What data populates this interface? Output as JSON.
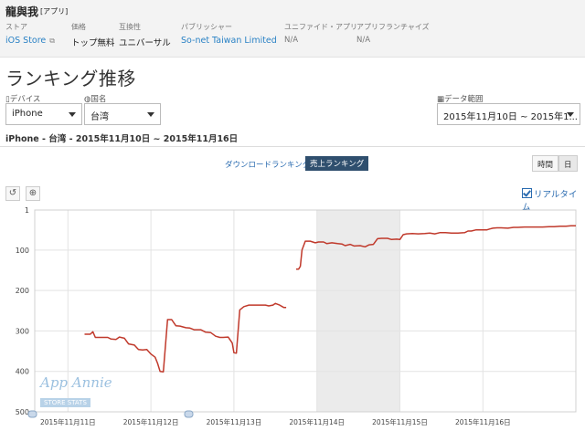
{
  "app": {
    "name": "龍與我",
    "tag": "[アプリ]"
  },
  "meta": {
    "store_label": "ストア",
    "store_value": "iOS Store",
    "price_label": "価格",
    "price_value": "トップ無料",
    "compat_label": "互換性",
    "compat_value": "ユニバーサル",
    "publisher_label": "パブリッシャー",
    "publisher_value": "So-net Taiwan Limited",
    "unified_label": "ユニファイド・アプリ",
    "unified_value": "N/A",
    "franchise_label": "アプリフランチャイズ",
    "franchise_value": "N/A"
  },
  "section_title": "ランキング推移",
  "filters": {
    "device_label": "デバイス",
    "device_value": "iPhone",
    "country_label": "国名",
    "country_value": "台湾",
    "date_label": "データ範囲",
    "date_value": "2015年11月10日 ~ 2015年1..."
  },
  "range_text": "iPhone - 台湾 - 2015年11月10日 ~ 2015年11月16日",
  "tabs": {
    "downloads": "ダウンロードランキング",
    "sales": "売上ランキング"
  },
  "granularity": {
    "hour": "時間",
    "day": "日"
  },
  "realtime_label": "リアルタイム",
  "watermark": {
    "brand": "App Annie",
    "sub": "STORE STATS"
  },
  "colors": {
    "line": "#c0392b",
    "shade": "#ebebeb",
    "accent": "#2a82c5"
  },
  "chart_data": {
    "type": "line",
    "title": "",
    "xlabel": "",
    "ylabel": "",
    "y_inverted": true,
    "ylim": [
      1,
      500
    ],
    "yticks": [
      "1",
      "100",
      "200",
      "300",
      "400",
      "500"
    ],
    "xticks": [
      "2015年11月11日",
      "2015年11月12日",
      "2015年11月13日",
      "2015年11月14日",
      "2015年11月15日",
      "2015年11月16日"
    ],
    "x_unit": "days since 2015-11-10 00:00",
    "grid": true,
    "shaded_range": [
      4.0,
      5.0
    ],
    "series": [
      {
        "name": "",
        "segments": [
          [
            [
              1.2,
              308
            ],
            [
              1.27,
              308
            ],
            [
              1.3,
              302
            ],
            [
              1.33,
              316
            ],
            [
              1.4,
              316
            ],
            [
              1.48,
              316
            ],
            [
              1.52,
              320
            ],
            [
              1.58,
              321
            ],
            [
              1.62,
              315
            ],
            [
              1.68,
              318
            ],
            [
              1.73,
              332
            ],
            [
              1.8,
              335
            ],
            [
              1.85,
              346
            ],
            [
              1.9,
              347
            ],
            [
              1.95,
              346
            ],
            [
              2.0,
              357
            ],
            [
              2.05,
              365
            ],
            [
              2.08,
              380
            ],
            [
              2.11,
              400
            ],
            [
              2.15,
              401
            ],
            [
              2.2,
              272
            ],
            [
              2.25,
              272
            ],
            [
              2.3,
              287
            ],
            [
              2.35,
              288
            ],
            [
              2.42,
              292
            ],
            [
              2.47,
              293
            ],
            [
              2.52,
              297
            ],
            [
              2.6,
              297
            ],
            [
              2.66,
              303
            ],
            [
              2.72,
              304
            ],
            [
              2.78,
              313
            ],
            [
              2.83,
              316
            ],
            [
              2.87,
              316
            ],
            [
              2.93,
              315
            ],
            [
              2.98,
              330
            ],
            [
              3.0,
              354
            ],
            [
              3.03,
              355
            ],
            [
              3.07,
              248
            ],
            [
              3.12,
              240
            ],
            [
              3.18,
              236
            ],
            [
              3.25,
              236
            ],
            [
              3.32,
              236
            ],
            [
              3.38,
              236
            ],
            [
              3.42,
              238
            ],
            [
              3.47,
              236
            ],
            [
              3.5,
              232
            ],
            [
              3.55,
              236
            ],
            [
              3.6,
              242
            ],
            [
              3.63,
              242
            ]
          ],
          [
            [
              3.75,
              147
            ],
            [
              3.78,
              147
            ],
            [
              3.8,
              140
            ],
            [
              3.82,
              100
            ],
            [
              3.86,
              78
            ],
            [
              3.92,
              78
            ],
            [
              3.98,
              82
            ],
            [
              4.02,
              80
            ],
            [
              4.08,
              80
            ],
            [
              4.12,
              84
            ],
            [
              4.18,
              82
            ],
            [
              4.25,
              84
            ],
            [
              4.3,
              85
            ],
            [
              4.34,
              89
            ],
            [
              4.4,
              86
            ],
            [
              4.45,
              90
            ],
            [
              4.52,
              89
            ],
            [
              4.58,
              92
            ],
            [
              4.63,
              87
            ],
            [
              4.68,
              86
            ],
            [
              4.73,
              72
            ],
            [
              4.78,
              71
            ],
            [
              4.85,
              71
            ],
            [
              4.9,
              74
            ],
            [
              4.96,
              73
            ],
            [
              5.0,
              74
            ],
            [
              5.04,
              62
            ],
            [
              5.08,
              60
            ],
            [
              5.15,
              59
            ],
            [
              5.22,
              60
            ],
            [
              5.3,
              59
            ],
            [
              5.36,
              58
            ],
            [
              5.42,
              60
            ],
            [
              5.48,
              57
            ],
            [
              5.55,
              57
            ],
            [
              5.62,
              58
            ],
            [
              5.7,
              58
            ],
            [
              5.78,
              57
            ],
            [
              5.82,
              53
            ],
            [
              5.86,
              53
            ],
            [
              5.92,
              50
            ],
            [
              5.98,
              50
            ],
            [
              6.05,
              50
            ],
            [
              6.08,
              48
            ],
            [
              6.12,
              46
            ],
            [
              6.17,
              45
            ],
            [
              6.22,
              45
            ],
            [
              6.3,
              46
            ],
            [
              6.37,
              44
            ],
            [
              6.42,
              44
            ],
            [
              6.5,
              43
            ],
            [
              6.58,
              43
            ],
            [
              6.65,
              43
            ],
            [
              6.72,
              43
            ],
            [
              6.8,
              42
            ],
            [
              6.86,
              42
            ],
            [
              6.93,
              41
            ],
            [
              7.0,
              41
            ],
            [
              7.06,
              40
            ],
            [
              7.12,
              40
            ]
          ]
        ]
      }
    ]
  }
}
